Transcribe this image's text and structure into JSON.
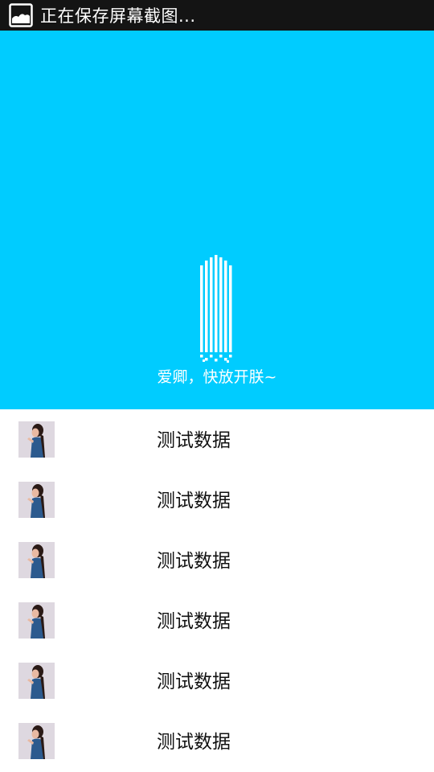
{
  "status_bar": {
    "notification_icon": "image-icon",
    "text": "正在保存屏幕截图..."
  },
  "refresh_header": {
    "background": "#00ccff",
    "animation_icon": "bars-loading-icon",
    "text": "爱卿，快放开朕~"
  },
  "list": {
    "items": [
      {
        "thumbnail": "avatar-photo",
        "label": "测试数据"
      },
      {
        "thumbnail": "avatar-photo",
        "label": "测试数据"
      },
      {
        "thumbnail": "avatar-photo",
        "label": "测试数据"
      },
      {
        "thumbnail": "avatar-photo",
        "label": "测试数据"
      },
      {
        "thumbnail": "avatar-photo",
        "label": "测试数据"
      },
      {
        "thumbnail": "avatar-photo",
        "label": "测试数据"
      }
    ]
  }
}
